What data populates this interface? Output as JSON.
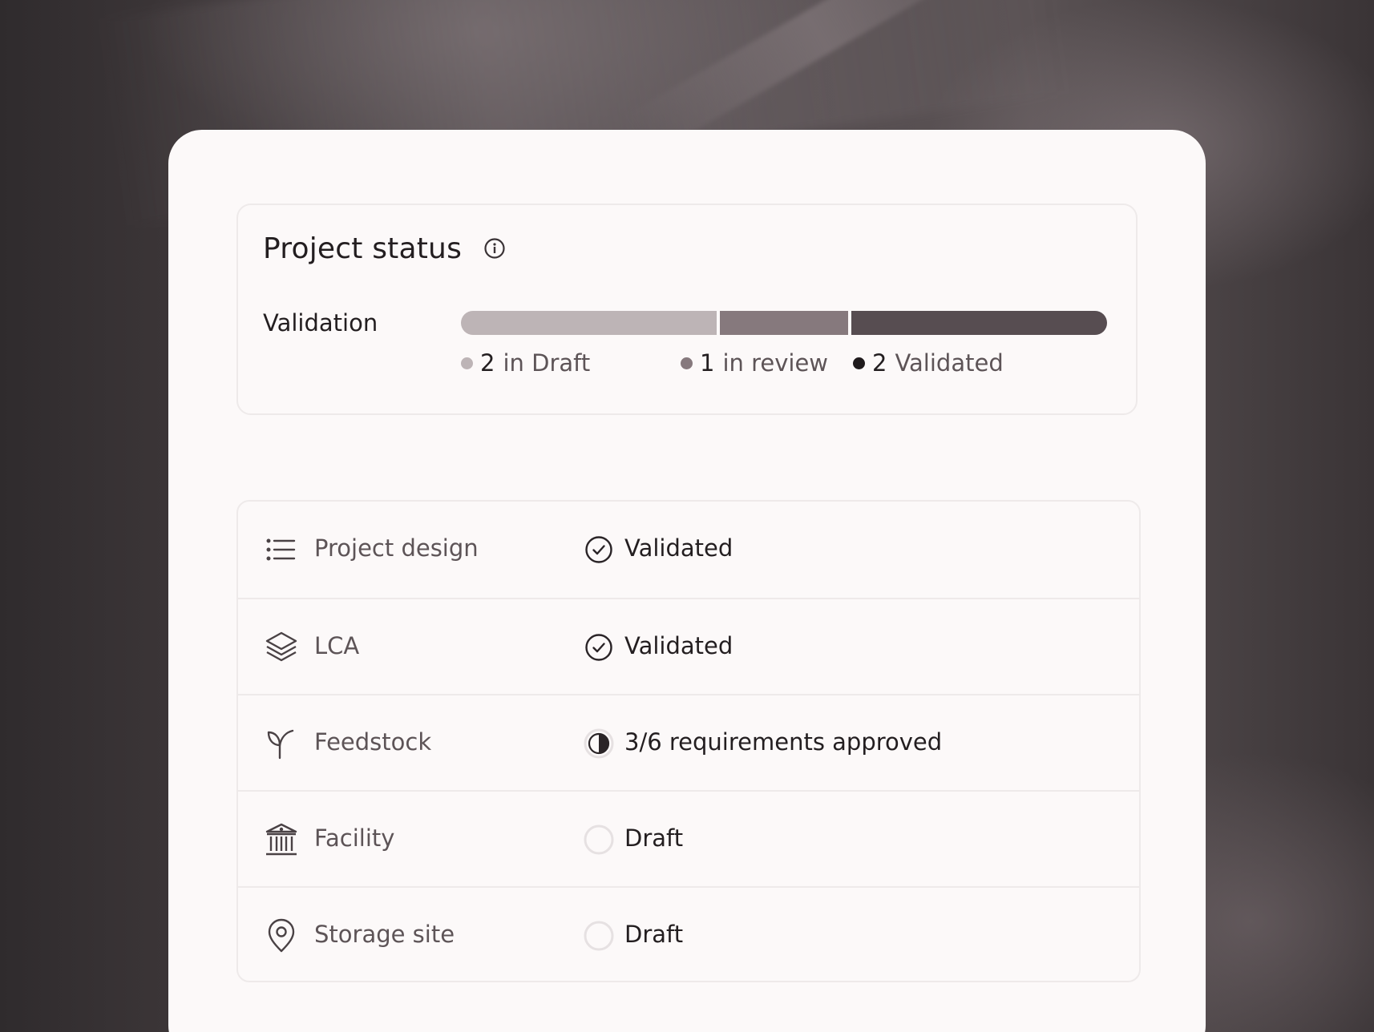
{
  "status": {
    "title": "Project status",
    "info_icon": "info-icon",
    "validation_label": "Validation",
    "progress": [
      {
        "key": "draft",
        "count": "2",
        "label": "in Draft",
        "fraction": 0.4,
        "color": "#bdb4b6"
      },
      {
        "key": "review",
        "count": "1",
        "label": "in review",
        "fraction": 0.2,
        "color": "#86797d"
      },
      {
        "key": "validated",
        "count": "2",
        "label": "Validated",
        "fraction": 0.4,
        "color": "#574d51"
      }
    ]
  },
  "items": [
    {
      "label": "Project design",
      "icon": "list-icon",
      "status": "Validated",
      "status_icon": "check-circle-icon"
    },
    {
      "label": "LCA",
      "icon": "layers-icon",
      "status": "Validated",
      "status_icon": "check-circle-icon"
    },
    {
      "label": "Feedstock",
      "icon": "sprout-icon",
      "status": "3/6 requirements approved",
      "status_icon": "half-circle-icon",
      "progress": 0.5
    },
    {
      "label": "Facility",
      "icon": "building-icon",
      "status": "Draft",
      "status_icon": "empty-circle-icon"
    },
    {
      "label": "Storage site",
      "icon": "map-pin-icon",
      "status": "Draft",
      "status_icon": "empty-circle-icon"
    }
  ]
}
